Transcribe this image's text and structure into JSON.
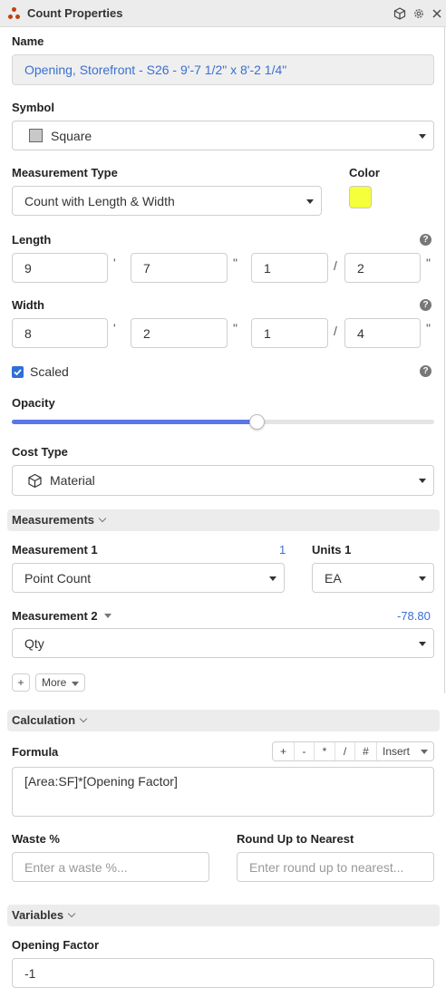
{
  "header": {
    "title": "Count Properties"
  },
  "name": {
    "label": "Name",
    "value": "Opening, Storefront - S26 - 9'-7 1/2\" x 8'-2 1/4\""
  },
  "symbol": {
    "label": "Symbol",
    "value": "Square"
  },
  "measurement_type": {
    "label": "Measurement Type",
    "value": "Count with Length & Width"
  },
  "color": {
    "label": "Color",
    "swatch": "#f5ff3a"
  },
  "length": {
    "label": "Length",
    "feet": "9",
    "inches": "7",
    "num": "1",
    "den": "2",
    "feet_mark": "'",
    "inch_mark": "\"",
    "slash": "/"
  },
  "width": {
    "label": "Width",
    "feet": "8",
    "inches": "2",
    "num": "1",
    "den": "4",
    "feet_mark": "'",
    "inch_mark": "\"",
    "slash": "/"
  },
  "scaled": {
    "label": "Scaled",
    "checked": true
  },
  "opacity": {
    "label": "Opacity",
    "value_fraction": 0.58
  },
  "cost_type": {
    "label": "Cost Type",
    "value": "Material"
  },
  "measurements": {
    "section_label": "Measurements",
    "m1": {
      "label": "Measurement 1",
      "value_text": "1",
      "select": "Point Count"
    },
    "units1": {
      "label": "Units 1",
      "select": "EA"
    },
    "m2": {
      "label": "Measurement 2",
      "value_text": "-78.80",
      "select": "Qty"
    },
    "add_label": "+",
    "more_label": "More"
  },
  "calculation": {
    "section_label": "Calculation",
    "formula_label": "Formula",
    "formula_value": "[Area:SF]*[Opening Factor]",
    "ops": [
      "+",
      "-",
      "*",
      "/",
      "#"
    ],
    "insert_label": "Insert",
    "waste_label": "Waste %",
    "waste_placeholder": "Enter a waste %...",
    "round_label": "Round Up to Nearest",
    "round_placeholder": "Enter round up to nearest..."
  },
  "variables": {
    "section_label": "Variables",
    "opening_factor_label": "Opening Factor",
    "opening_factor_value": "-1"
  },
  "colors": {
    "accent": "#3b6fd1",
    "slider": "#5b76e8"
  }
}
